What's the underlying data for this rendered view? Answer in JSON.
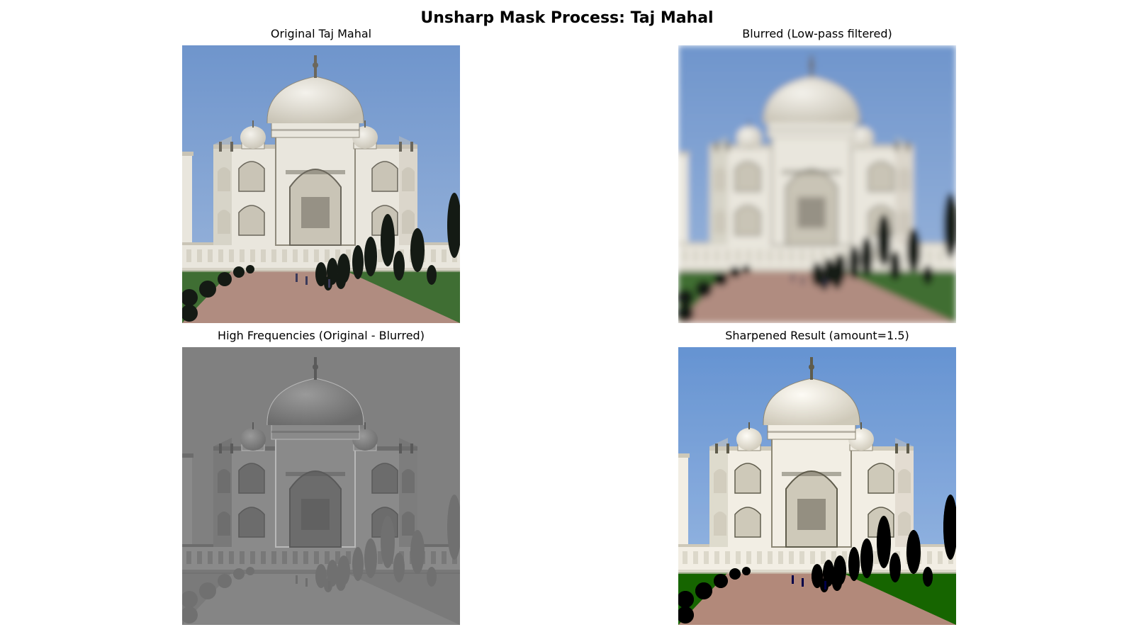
{
  "figure": {
    "title": "Unsharp Mask Process: Taj Mahal"
  },
  "panels": [
    {
      "title": "Original Taj Mahal",
      "variant": "original"
    },
    {
      "title": "Blurred (Low-pass filtered)",
      "variant": "blurred"
    },
    {
      "title": "High Frequencies (Original - Blurred)",
      "variant": "highpass"
    },
    {
      "title": "Sharpened Result (amount=1.5)",
      "variant": "sharpened"
    }
  ],
  "colors": {
    "sky_top": "#6f95cc",
    "sky_bottom": "#9db7dc",
    "marble": "#e9e6dd",
    "marble_shadow": "#c9c4b6",
    "tree": "#141a14",
    "lawn": "#3f6e33",
    "path": "#b08c80",
    "highpass_gray": "#808080"
  }
}
